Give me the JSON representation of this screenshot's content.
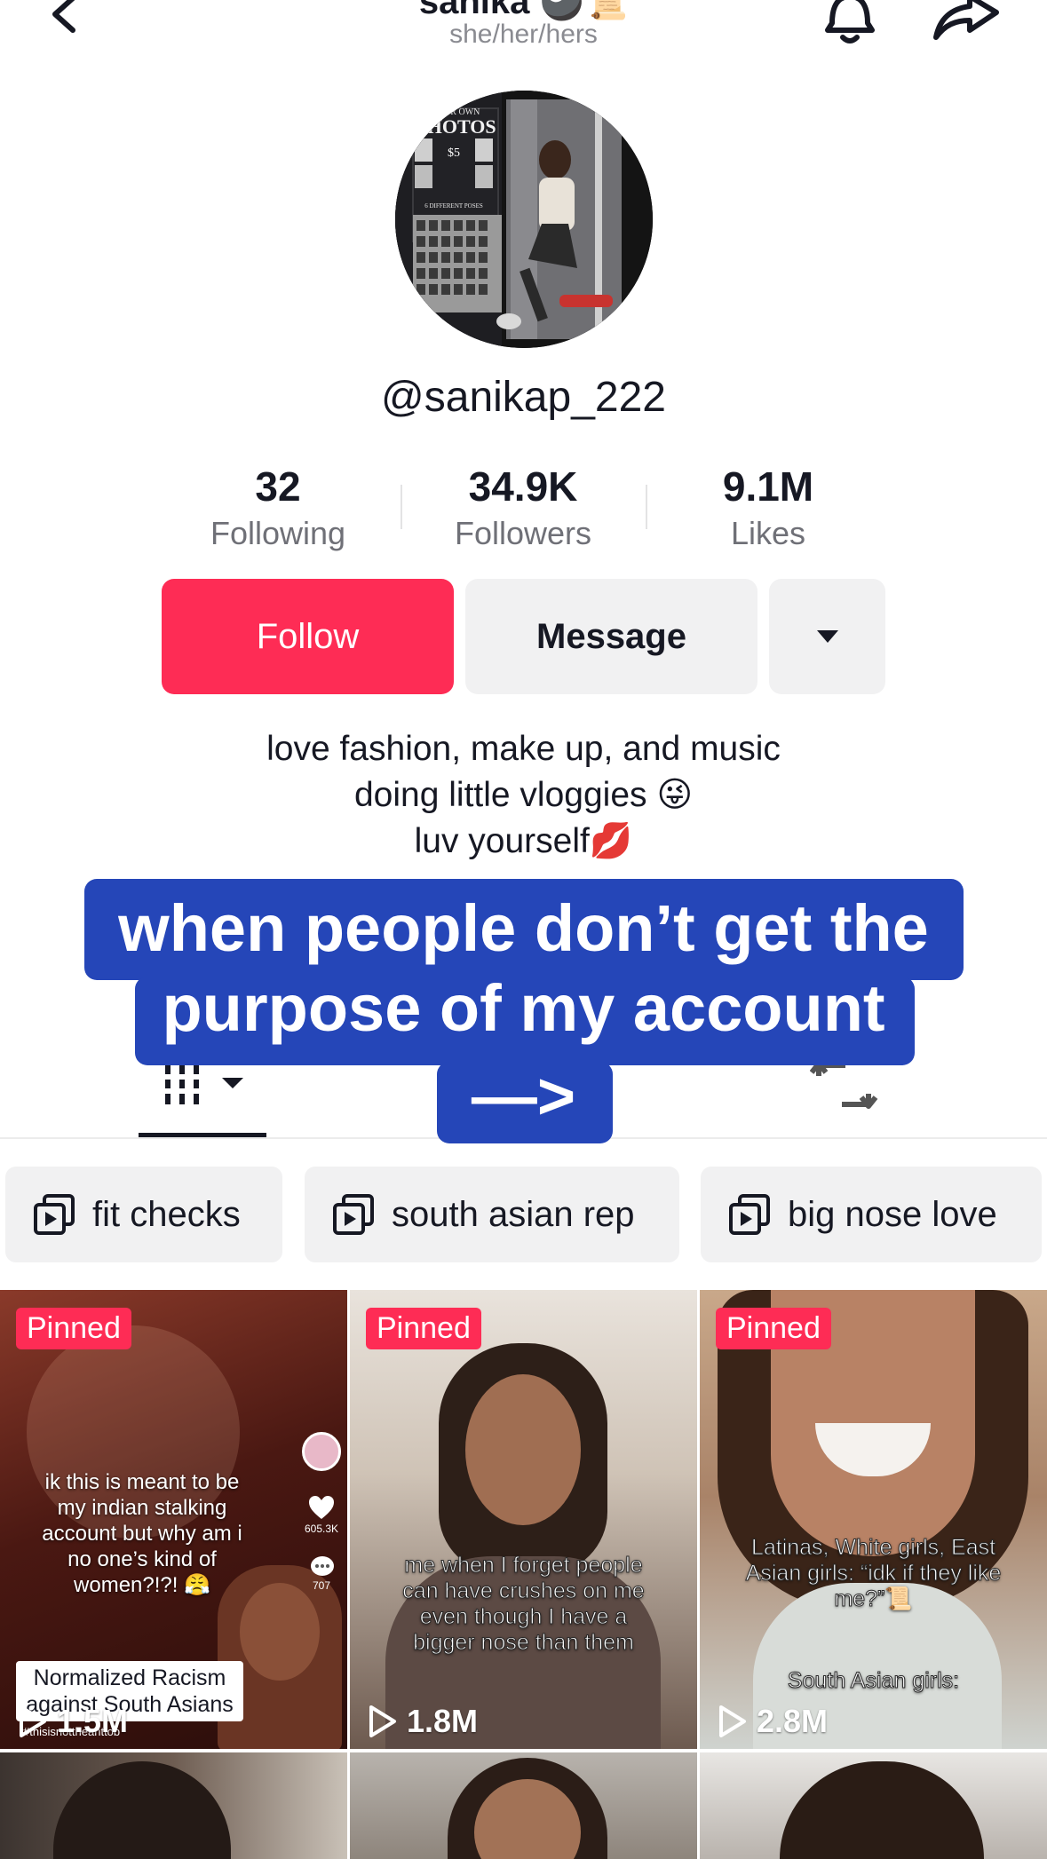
{
  "header": {
    "name": "sanika",
    "name_emoji": "🎱📜",
    "pronouns": "she/her/hers"
  },
  "profile": {
    "username": "@sanikap_222",
    "avatar_sign": {
      "line1": "YOUR OWN",
      "line2": "PHOTOS",
      "price": "$5",
      "poses": "6 DIFFERENT POSES"
    }
  },
  "stats": [
    {
      "value": "32",
      "label": "Following"
    },
    {
      "value": "34.9K",
      "label": "Followers"
    },
    {
      "value": "9.1M",
      "label": "Likes"
    }
  ],
  "actions": {
    "follow": "Follow",
    "message": "Message"
  },
  "bio": {
    "line1": "love fashion, make up, and music",
    "line2": "doing little vloggies 😜",
    "line3": "luv yourself💋"
  },
  "overlay": {
    "line1": "when people don’t get the",
    "line2": "purpose of my account",
    "line3": "—>"
  },
  "playlists": [
    {
      "label": "fit checks"
    },
    {
      "label": "south asian rep"
    },
    {
      "label": "big nose love"
    }
  ],
  "videos": [
    {
      "badge": "Pinned",
      "views": "1.5M",
      "text": "ik this is meant to be my indian stalking account but why am i no one’s kind of women?!?! 😤",
      "label": "Normalized Racism against South Asians",
      "side_likes": "605.3K",
      "side_comments": "707",
      "hashtag": "#thisisnottheanttob"
    },
    {
      "badge": "Pinned",
      "views": "1.8M",
      "text": "me when I forget people can have crushes on me even though I have a bigger nose than them"
    },
    {
      "badge": "Pinned",
      "views": "2.8M",
      "text": "Latinas, White girls, East Asian girls: “idk if they like me?”📜",
      "text2": "South Asian girls:"
    }
  ]
}
